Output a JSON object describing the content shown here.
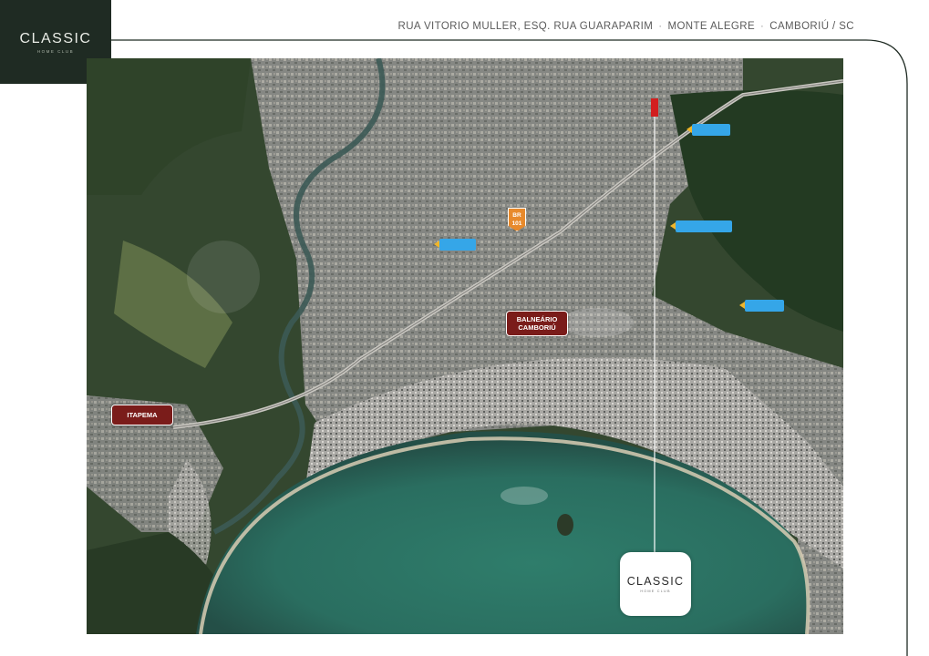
{
  "logo": {
    "name": "CLASSIC",
    "subtitle": "HOME CLUB"
  },
  "header": {
    "street": "RUA VITORIO MULLER, ESQ. RUA GUARAPARIM",
    "neighborhood": "MONTE ALEGRE",
    "city": "CAMBORIÚ / SC",
    "separator": "·"
  },
  "map": {
    "cities": [
      {
        "id": "balneario",
        "lines": [
          "BALNEÁRIO",
          "CAMBORIÚ"
        ]
      },
      {
        "id": "itapema",
        "lines": [
          "ITAPEMA"
        ]
      }
    ],
    "highway": {
      "prefix": "BR",
      "number": "101"
    },
    "pins": [
      {
        "id": "pin-1",
        "label": ""
      },
      {
        "id": "pin-2",
        "label": ""
      },
      {
        "id": "pin-3",
        "label": ""
      },
      {
        "id": "pin-4",
        "label": ""
      }
    ],
    "development": {
      "name": "CLASSIC",
      "subtitle": "HOME CLUB"
    },
    "colors": {
      "accent_pin": "#35a6e8",
      "pin_marker": "#f0b52a",
      "city_label": "#7a1c1a",
      "highway_shield": "#e88a2c",
      "brand_dark": "#1f2b23",
      "location_marker": "#d21f1f"
    }
  }
}
